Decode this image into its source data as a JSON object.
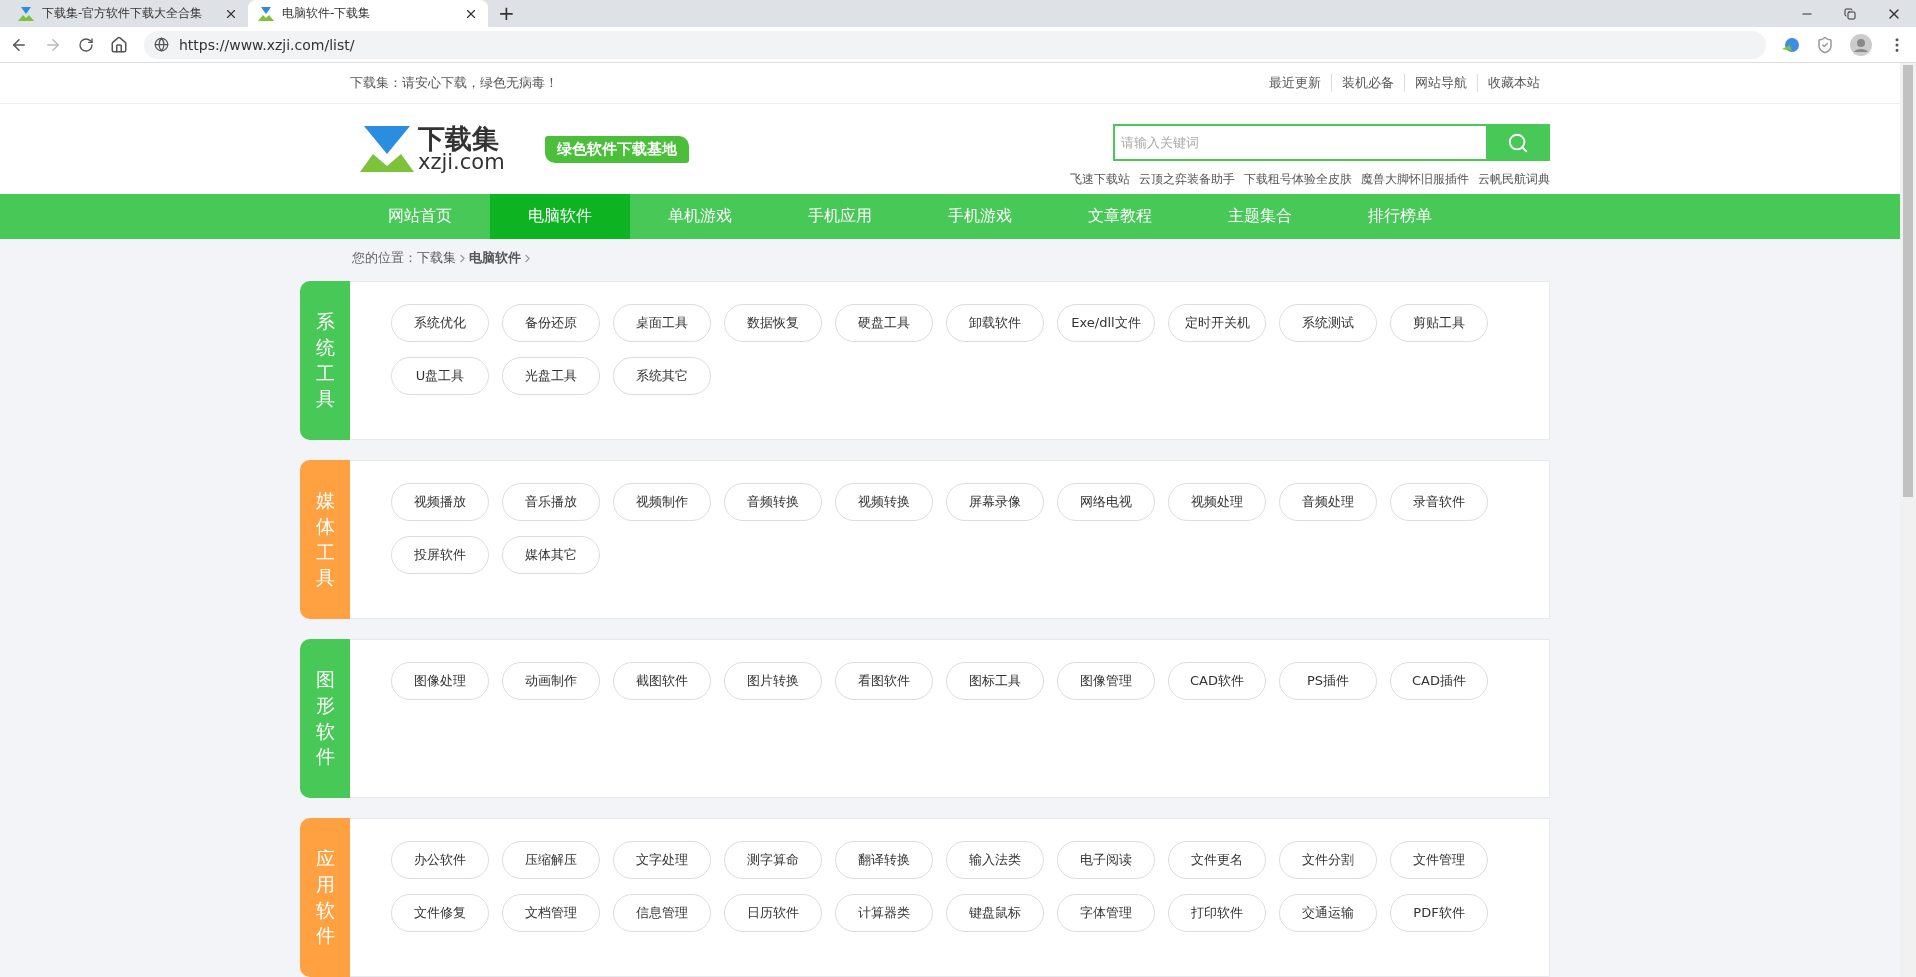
{
  "browser": {
    "tabs": [
      {
        "title": "下载集-官方软件下载大全合集",
        "selected": false
      },
      {
        "title": "电脑软件-下载集",
        "selected": true
      }
    ],
    "new_tab": "+",
    "url": "https://www.xzji.com/list/"
  },
  "top_bar": {
    "slogan": "下载集：请安心下载，绿色无病毒！",
    "links": [
      "最近更新",
      "装机必备",
      "网站导航",
      "收藏本站"
    ]
  },
  "header": {
    "logo": {
      "name": "下载集",
      "domain": "xzji.com"
    },
    "badge": "绿色软件下载基地",
    "search": {
      "placeholder": "请输入关键词"
    },
    "hot_links": [
      "飞速下载站",
      "云顶之弈装备助手",
      "下载租号体验全皮肤",
      "魔兽大脚怀旧服插件",
      "云帆民航词典"
    ]
  },
  "nav": [
    {
      "label": "网站首页",
      "selected": false
    },
    {
      "label": "电脑软件",
      "selected": true
    },
    {
      "label": "单机游戏",
      "selected": false
    },
    {
      "label": "手机应用",
      "selected": false
    },
    {
      "label": "手机游戏",
      "selected": false
    },
    {
      "label": "文章教程",
      "selected": false
    },
    {
      "label": "主题集合",
      "selected": false
    },
    {
      "label": "排行榜单",
      "selected": false
    }
  ],
  "breadcrumb": {
    "prefix": "您的位置：",
    "items": [
      "下载集",
      "电脑软件"
    ]
  },
  "categories": [
    {
      "title": "系统工具",
      "color": "#48c857",
      "tags": [
        "系统优化",
        "备份还原",
        "桌面工具",
        "数据恢复",
        "硬盘工具",
        "卸载软件",
        "Exe/dll文件",
        "定时开关机",
        "系统测试",
        "剪贴工具",
        "U盘工具",
        "光盘工具",
        "系统其它"
      ]
    },
    {
      "title": "媒体工具",
      "color": "#ffa140",
      "tags": [
        "视频播放",
        "音乐播放",
        "视频制作",
        "音频转换",
        "视频转换",
        "屏幕录像",
        "网络电视",
        "视频处理",
        "音频处理",
        "录音软件",
        "投屏软件",
        "媒体其它"
      ]
    },
    {
      "title": "图形软件",
      "color": "#48c857",
      "tags": [
        "图像处理",
        "动画制作",
        "截图软件",
        "图片转换",
        "看图软件",
        "图标工具",
        "图像管理",
        "CAD软件",
        "PS插件",
        "CAD插件"
      ]
    },
    {
      "title": "应用软件",
      "color": "#ffa140",
      "tags": [
        "办公软件",
        "压缩解压",
        "文字处理",
        "测字算命",
        "翻译转换",
        "输入法类",
        "电子阅读",
        "文件更名",
        "文件分割",
        "文件管理",
        "文件修复",
        "文档管理",
        "信息管理",
        "日历软件",
        "计算器类",
        "键盘鼠标",
        "字体管理",
        "打印软件",
        "交通运输",
        "PDF软件"
      ]
    }
  ]
}
